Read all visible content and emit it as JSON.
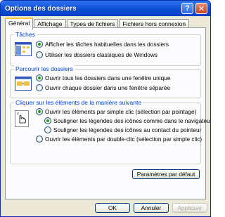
{
  "window": {
    "title": "Options des dossiers"
  },
  "titlebar": {
    "help": "?",
    "close": "✕"
  },
  "tabs": [
    "Général",
    "Affichage",
    "Types de fichiers",
    "Fichiers hors connexion"
  ],
  "groups": {
    "taches": {
      "title": "Tâches",
      "options": [
        {
          "label": "Afficher les tâches habituelles dans les dossiers",
          "selected": true
        },
        {
          "label": "Utiliser les dossiers classiques de Windows",
          "selected": false
        }
      ]
    },
    "parcourir": {
      "title": "Parcourir les dossiers",
      "options": [
        {
          "label": "Ouvrir tous les dossiers dans une fenêtre unique",
          "selected": true
        },
        {
          "label": "Ouvrir chaque dossier dans une fenêtre séparée",
          "selected": false
        }
      ]
    },
    "cliquer": {
      "title": "Cliquer sur les éléments de la manière suivante",
      "options": [
        {
          "label": "Ouvrir les éléments par simple clic (sélection par pointage)",
          "selected": true
        },
        {
          "label": "Souligner les légendes des icônes comme dans le navigateur",
          "selected": true
        },
        {
          "label": "Souligner les légendes des icônes au contact du pointeur",
          "selected": false
        },
        {
          "label": "Ouvrir les éléments par double-clic (sélection par simple clic)",
          "selected": false
        }
      ]
    }
  },
  "buttons": {
    "defaults": "Paramètres par défaut",
    "ok": "OK",
    "cancel": "Annuler",
    "apply": "Appliquer"
  }
}
